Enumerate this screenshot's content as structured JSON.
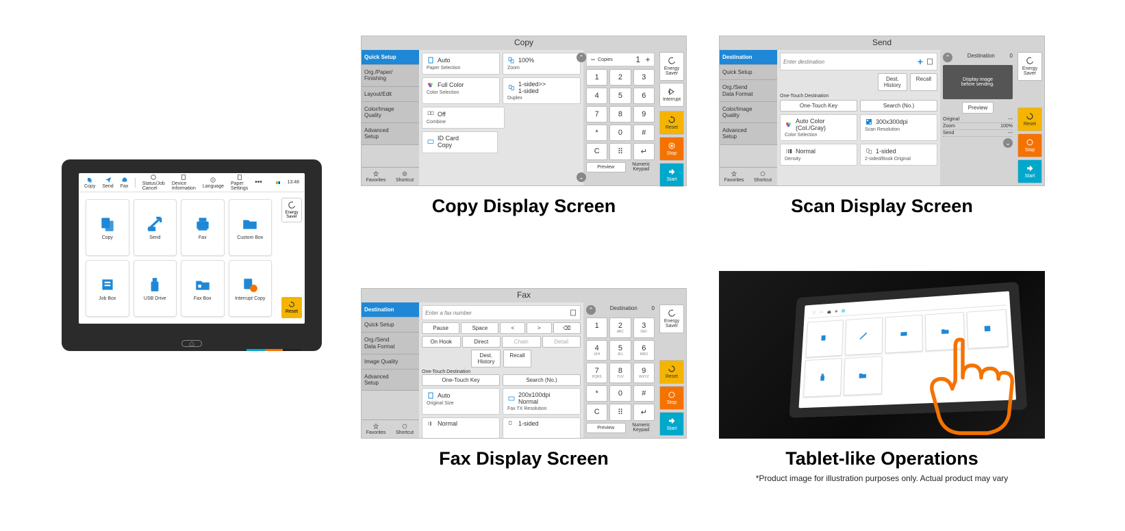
{
  "device": {
    "topbar": [
      "Copy",
      "Send",
      "Fax",
      "Status/Job Cancel",
      "Device Information",
      "Language",
      "Paper Settings"
    ],
    "time": "13:48",
    "tiles": [
      "Copy",
      "Send",
      "Fax",
      "Custom Box",
      "Job Box",
      "USB Drive",
      "Fax Box",
      "Interrupt Copy"
    ],
    "energy_saver": "Energy Saver",
    "reset": "Reset"
  },
  "copy": {
    "title": "Copy",
    "tabs": [
      "Quick Setup",
      "Org./Paper/\nFinishing",
      "Layout/Edit",
      "Color/Image\nQuality",
      "Advanced\nSetup"
    ],
    "favorites": "Favorites",
    "shortcut": "Shortcut",
    "tiles": {
      "auto": "Auto",
      "paper_sel": "Paper Selection",
      "zoom_val": "100%",
      "zoom": "Zoom",
      "full_color": "Full Color",
      "color_sel": "Color Selection",
      "duplex_val": "1-sided>>\n1-sided",
      "duplex": "Duplex",
      "off": "Off",
      "combine": "Combine",
      "idcard": "ID Card\nCopy"
    },
    "copies_label": "Copies",
    "copies_val": "1",
    "keypad": [
      "1",
      "2",
      "3",
      "4",
      "5",
      "6",
      "7",
      "8",
      "9",
      "*",
      "0",
      "#"
    ],
    "kp_c": "C",
    "kp_grid": "⠿",
    "kp_enter": "↵",
    "preview": "Preview",
    "numeric_keypad": "Numeric\nKeypad",
    "energy_saver": "Energy Saver",
    "interrupt": "Interrupt",
    "reset": "Reset",
    "stop": "Stop",
    "start": "Start"
  },
  "scan": {
    "title": "Send",
    "tabs": [
      "Destination",
      "Quick Setup",
      "Org./Send\nData Format",
      "Color/Image\nQuality",
      "Advanced\nSetup"
    ],
    "favorites": "Favorites",
    "shortcut": "Shortcut",
    "enter_dest": "Enter destination",
    "dest_history": "Dest.\nHistory",
    "recall": "Recall",
    "onetouch_dest": "One-Touch Destination",
    "onetouch_key": "One-Touch Key",
    "search_no": "Search (No.)",
    "auto_color": "Auto Color\n(Col./Gray)",
    "color_sel": "Color Selection",
    "resolution_val": "300x300dpi",
    "resolution": "Scan Resolution",
    "normal": "Normal",
    "density": "Density",
    "onesided": "1-sided",
    "book": "2-sided/Book Original",
    "destination_label": "Destination",
    "dest_count": "0",
    "preview_msg": "Display image\nbefore sending.",
    "preview": "Preview",
    "original": "Original",
    "original_val": "---",
    "zoom": "Zoom",
    "zoom_val": "100%",
    "send": "Send",
    "send_val": "---",
    "energy_saver": "Energy Saver",
    "reset": "Reset",
    "stop": "Stop",
    "start": "Start"
  },
  "fax": {
    "title": "Fax",
    "tabs": [
      "Destination",
      "Quick Setup",
      "Org./Send\nData Format",
      "Image Quality",
      "Advanced\nSetup"
    ],
    "favorites": "Favorites",
    "shortcut": "Shortcut",
    "enter_fax": "Enter a fax number",
    "pause": "Pause",
    "space": "Space",
    "lt": "<",
    "gt": ">",
    "del": "⌫",
    "onhook": "On Hook",
    "direct": "Direct",
    "chain": "Chain",
    "detail": "Detail",
    "dest_history": "Dest.\nHistory",
    "recall": "Recall",
    "onetouch_dest": "One-Touch Destination",
    "onetouch_key": "One-Touch Key",
    "search_no": "Search (No.)",
    "auto": "Auto",
    "orig_size": "Original Size",
    "res_val": "200x100dpi\nNormal",
    "res": "Fax TX Resolution",
    "normal": "Normal",
    "onesided": "1-sided",
    "destination_label": "Destination",
    "dest_count": "0",
    "keypad": [
      [
        "1",
        ""
      ],
      [
        "2",
        "ABC"
      ],
      [
        "3",
        "DEF"
      ],
      [
        "4",
        "GHI"
      ],
      [
        "5",
        "JKL"
      ],
      [
        "6",
        "MNO"
      ],
      [
        "7",
        "PQRS"
      ],
      [
        "8",
        "TUV"
      ],
      [
        "9",
        "WXYZ"
      ],
      [
        "*",
        ""
      ],
      [
        "0",
        ""
      ],
      [
        "#",
        ""
      ]
    ],
    "kp_c": "C",
    "kp_grid": "⠿",
    "kp_enter": "↵",
    "preview": "Preview",
    "numeric_keypad": "Numeric\nKeypad",
    "energy_saver": "Energy Saver",
    "reset": "Reset",
    "stop": "Stop",
    "start": "Start"
  },
  "captions": {
    "copy": "Copy Display Screen",
    "scan": "Scan Display Screen",
    "fax": "Fax Display Screen",
    "tablet": "Tablet-like Operations",
    "footnote": "*Product image for illustration purposes only. Actual product may vary"
  }
}
